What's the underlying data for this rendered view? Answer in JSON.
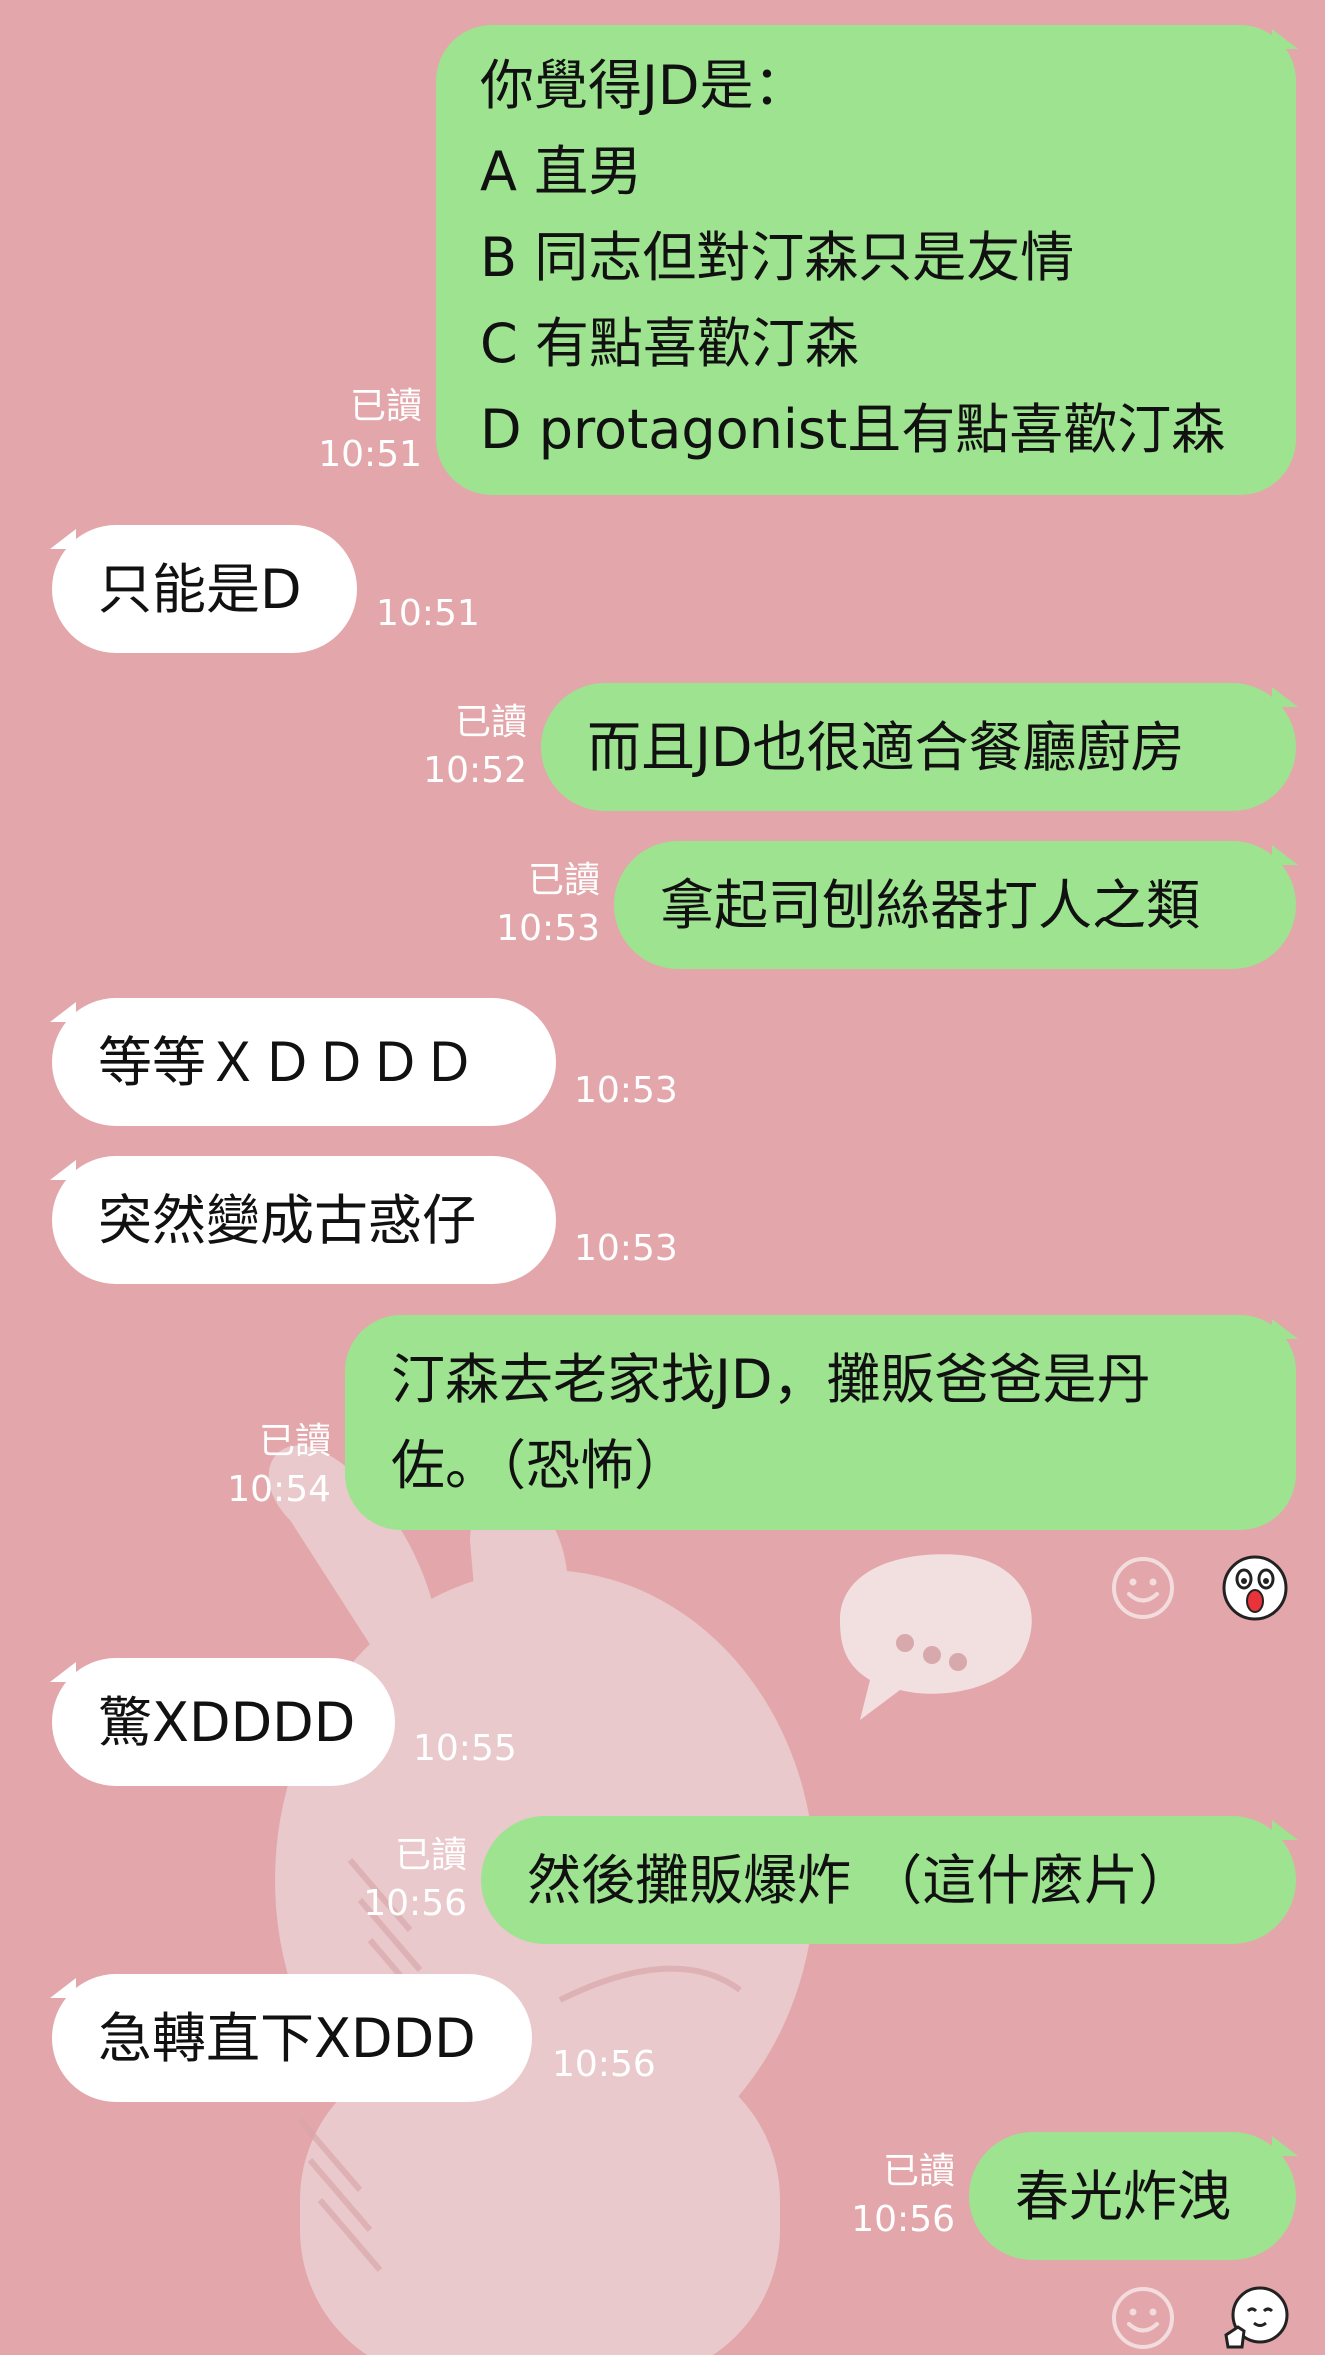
{
  "messages": [
    {
      "dir": "out",
      "lines": [
        "你覺得JD是：",
        "A 直男",
        "B 同志但對汀森只是友情",
        "C 有點喜歡汀森",
        "D protagonist且有點喜歡汀森"
      ],
      "read": "已讀",
      "time": "10:51"
    },
    {
      "dir": "in",
      "lines": [
        "只能是D"
      ],
      "time": "10:51"
    },
    {
      "dir": "out",
      "lines": [
        "而且JD也很適合餐廳廚房"
      ],
      "read": "已讀",
      "time": "10:52"
    },
    {
      "dir": "out",
      "lines": [
        "拿起司刨絲器打人之類"
      ],
      "read": "已讀",
      "time": "10:53"
    },
    {
      "dir": "in",
      "lines": [
        "等等ＸＤＤＤＤ"
      ],
      "time": "10:53"
    },
    {
      "dir": "in",
      "lines": [
        "突然變成古惑仔"
      ],
      "time": "10:53"
    },
    {
      "dir": "out",
      "lines": [
        "汀森去老家找JD，攤販爸爸是丹",
        "佐。（恐怖）"
      ],
      "read": "已讀",
      "time": "10:54",
      "reaction": "shocked-face-sticker"
    },
    {
      "dir": "in",
      "lines": [
        "驚XDDDD"
      ],
      "time": "10:55"
    },
    {
      "dir": "out",
      "lines": [
        "然後攤販爆炸 （這什麼片）"
      ],
      "read": "已讀",
      "time": "10:56"
    },
    {
      "dir": "in",
      "lines": [
        "急轉直下XDDD"
      ],
      "time": "10:56"
    },
    {
      "dir": "out",
      "lines": [
        "春光炸洩"
      ],
      "read": "已讀",
      "time": "10:56",
      "reaction": "thumbs-up-sticker"
    }
  ],
  "colors": {
    "background": "#e3a7ab",
    "outgoing": "#9de390",
    "incoming": "#ffffff",
    "meta": "#ffffff"
  },
  "icons": {
    "add_reaction": "smiley-icon"
  }
}
